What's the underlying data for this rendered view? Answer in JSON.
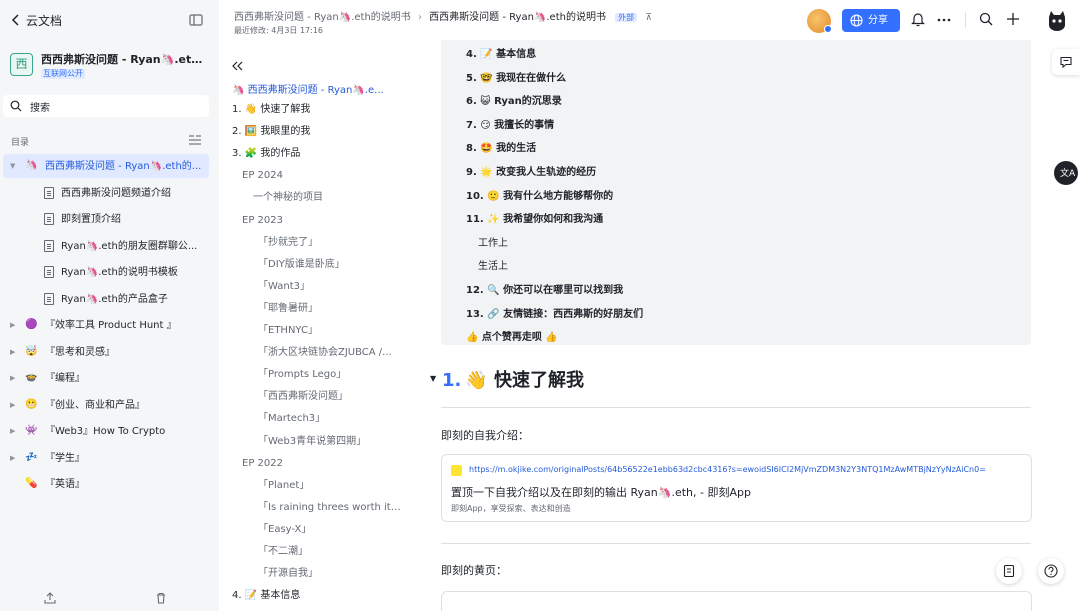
{
  "sidebar": {
    "app_title": "云文档",
    "space": {
      "icon_char": "西",
      "title": "西西弗斯没问题 - Ryan🦄.eth的...",
      "badge": "互联网公开"
    },
    "search_label": "搜索",
    "toc_label": "目录",
    "tree": [
      {
        "emoji": "🦄",
        "label": "西西弗斯没问题 - Ryan🦄.eth的...",
        "active": true,
        "caret": "▼"
      },
      {
        "label": "西西弗斯没问题频道介绍"
      },
      {
        "label": "即刻置顶介绍"
      },
      {
        "label": "Ryan🦄.eth的朋友圈群聊公..."
      },
      {
        "label": "Ryan🦄.eth的说明书模板"
      },
      {
        "label": "Ryan🦄.eth的产品盒子"
      },
      {
        "emoji": "🟣",
        "label": "『效率工具 Product Hunt 』",
        "caret": "▶"
      },
      {
        "emoji": "🤯",
        "label": "『思考和灵感』",
        "caret": "▶"
      },
      {
        "emoji": "🍲",
        "label": "『编程』",
        "caret": "▶"
      },
      {
        "emoji": "😬",
        "label": "『创业、商业和产品』",
        "caret": "▶"
      },
      {
        "emoji": "👾",
        "label": "『Web3』How To Crypto",
        "caret": "▶"
      },
      {
        "emoji": "💤",
        "label": "『学生』",
        "caret": "▶"
      },
      {
        "emoji": "💊",
        "label": "『英语』",
        "caret": ""
      }
    ]
  },
  "header": {
    "breadcrumb_parent": "西西弗斯没问题 - Ryan🦄.eth的说明书",
    "breadcrumb_current": "西西弗斯没问题 - Ryan🦄.eth的说明书",
    "external_badge": "外部",
    "modified": "最近修改: 4月3日 17:16",
    "share_label": "分享"
  },
  "toc": {
    "title": "🦄 西西弗斯没问题 - Ryan🦄.e...",
    "items": [
      {
        "level": "l1",
        "label": "1. 👋 快速了解我"
      },
      {
        "level": "l1",
        "label": "2. 🖼️ 我眼里的我"
      },
      {
        "level": "l1",
        "label": "3. 🧩 我的作品"
      },
      {
        "level": "l2",
        "label": "EP 2024"
      },
      {
        "level": "l3",
        "label": "一个神秘的项目"
      },
      {
        "level": "l2",
        "label": "EP 2023"
      },
      {
        "level": "l3b",
        "label": "「抄就完了」"
      },
      {
        "level": "l3b",
        "label": "「DIY版谁是卧底」"
      },
      {
        "level": "l3b",
        "label": "「Want3」"
      },
      {
        "level": "l3b",
        "label": "「耶鲁暑研」"
      },
      {
        "level": "l3b",
        "label": "「ETHNYC」"
      },
      {
        "level": "l3b",
        "label": "「浙大区块链协会ZJUBCA /..."
      },
      {
        "level": "l3b",
        "label": "「Prompts Lego」"
      },
      {
        "level": "l3b",
        "label": "「西西弗斯没问题」"
      },
      {
        "level": "l3b",
        "label": "「Martech3」"
      },
      {
        "level": "l3b",
        "label": "「Web3青年说第四期」"
      },
      {
        "level": "l2",
        "label": "EP 2022"
      },
      {
        "level": "l3b",
        "label": "「Planet」"
      },
      {
        "level": "l3b",
        "label": "「Is raining threes worth it?..."
      },
      {
        "level": "l3b",
        "label": "「Easy-X」"
      },
      {
        "level": "l3b",
        "label": "「不二潮」"
      },
      {
        "level": "l3b",
        "label": "「开源自我」"
      },
      {
        "level": "l1",
        "label": "4. 📝 基本信息"
      }
    ]
  },
  "content": {
    "callout_items": [
      {
        "label": "4. 📝 基本信息",
        "sub": false
      },
      {
        "label": "5. 🤓 我现在在做什么",
        "sub": false
      },
      {
        "label": "6. 😺 Ryan的沉思录",
        "sub": false
      },
      {
        "label": "7. 😏 我擅长的事情",
        "sub": false
      },
      {
        "label": "8. 🤩 我的生活",
        "sub": false
      },
      {
        "label": "9. 🌟 改变我人生轨迹的经历",
        "sub": false
      },
      {
        "label": "10. 🙂 我有什么地方能够帮你的",
        "sub": false
      },
      {
        "label": "11. ✨ 我希望你如何和我沟通",
        "sub": false
      },
      {
        "label": "工作上",
        "sub": true
      },
      {
        "label": "生活上",
        "sub": true
      },
      {
        "label": "12. 🔍 你还可以在哪里可以找到我",
        "sub": false
      },
      {
        "label": "13. 🔗 友情链接：西西弗斯的好朋友们",
        "sub": false
      },
      {
        "label": "👍 点个赞再走呗 👍",
        "sub": false
      }
    ],
    "heading_number": "1.",
    "heading_text": "👋 快速了解我",
    "intro_label": "即刻的自我介绍：",
    "link_card": {
      "url": "https://m.okjike.com/originalPosts/64b56522e1ebb63d2cbc4316?s=ewoidSI6ICI2MjVmZDM3N2Y3NTQ1MzAwMTBjNzYyNzAiCn0=",
      "title": "置顶一下自我介绍以及在即刻的输出 Ryan🦄.eth, - 即刻App",
      "desc": "即刻App，享受探索、表达和创造"
    },
    "yellow_page_label": "即刻的黄页："
  },
  "colors": {
    "accent": "#3370ff",
    "active_bg": "#e0e9ff",
    "sidebar_bg": "#f5f6f7",
    "callout_bg": "#f2f3f5"
  }
}
